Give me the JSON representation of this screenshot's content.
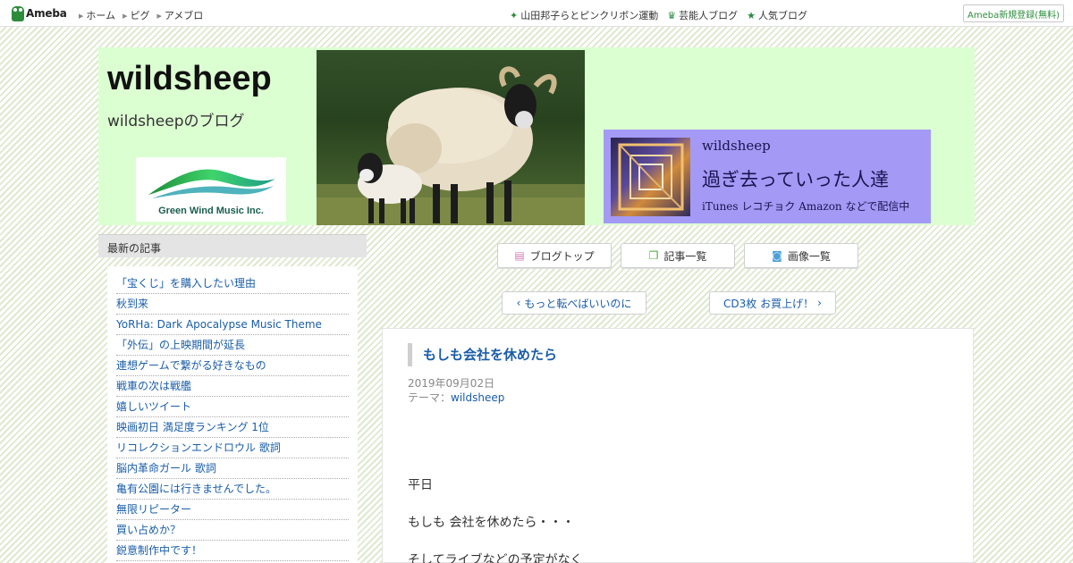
{
  "topbar": {
    "logo_text": "Ameba",
    "nav_left": [
      {
        "label": "ホーム"
      },
      {
        "label": "ピグ"
      },
      {
        "label": "アメブロ"
      }
    ],
    "nav_right": [
      {
        "icon": "sparkle-icon",
        "label": "山田邦子らとピンクリボン運動"
      },
      {
        "icon": "crown-icon",
        "label": "芸能人ブログ"
      },
      {
        "icon": "star-icon",
        "label": "人気ブログ"
      }
    ],
    "signup_label": "Ameba新規登録(無料)"
  },
  "header": {
    "blog_title": "wildsheep",
    "blog_description": "wildsheepのブログ",
    "logo_caption": "Green Wind Music Inc.",
    "promo": {
      "artist": "wildsheep",
      "song": "過ぎ去っていった人達",
      "subtitle": "iTunes レコチョク Amazon などで配信中"
    }
  },
  "sidebar": {
    "heading": "最新の記事",
    "items": [
      "「宝くじ」を購入したい理由",
      "秋到来",
      "YoRHa: Dark Apocalypse Music Theme",
      "「外伝」の上映期間が延長",
      "連想ゲームで繋がる好きなもの",
      "戦車の次は戦艦",
      "嬉しいツイート",
      "映画初日 満足度ランキング 1位",
      "リコレクションエンドロウル 歌詞",
      "脳内革命ガール 歌詞",
      "亀有公園には行きませんでした。",
      "無限リピーター",
      "買い占めか？",
      "鋭意制作中です！"
    ]
  },
  "nav_buttons": {
    "blog_top": "ブログトップ",
    "article_list": "記事一覧",
    "image_list": "画像一覧"
  },
  "pager": {
    "prev": "もっと転べばいいのに",
    "next": "CD3枚 お買上げ！"
  },
  "article": {
    "title": "もしも会社を休めたら",
    "date": "2019年09月02日",
    "theme_label": "テーマ：",
    "theme": "wildsheep",
    "paragraphs": [
      "平日",
      "もしも 会社を休めたら・・・",
      "そしてライブなどの予定がなく"
    ]
  }
}
